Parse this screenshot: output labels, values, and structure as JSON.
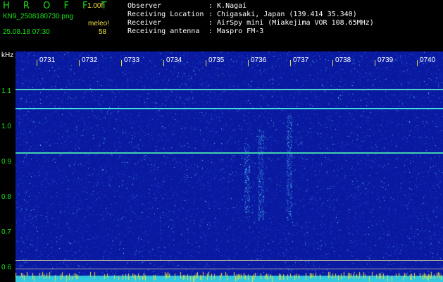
{
  "header": {
    "brand": "H R O F F T",
    "version": "1.00f",
    "filename": "KN9_2508180730.png",
    "datetime": "25.08.18 07:30",
    "unit_label": "meleo!",
    "unit_value": "58"
  },
  "meta": [
    {
      "key": "Observer",
      "value": ": K.Nagai"
    },
    {
      "key": "Receiving Location",
      "value": ": Chigasaki, Japan (139.414 35.340)"
    },
    {
      "key": "Receiver",
      "value": ": AirSpy mini (Miakejima VOR 108.65MHz)"
    },
    {
      "key": "Receiving antenna",
      "value": ": Maspro FM-3"
    }
  ],
  "axis": {
    "unit": "kHz",
    "freq_labels": [
      "1.1",
      "1.0",
      "0.9",
      "0.8",
      "0.7",
      "0.6"
    ],
    "time_labels": [
      "0731",
      "0732",
      "0733",
      "0734",
      "0735",
      "0736",
      "0737",
      "0738",
      "0739",
      "0740"
    ]
  },
  "colors": {
    "background": "#0a1aa0",
    "trace": "#40e0e0",
    "label_green": "#18e318",
    "label_yellow": "#f0e040"
  }
}
